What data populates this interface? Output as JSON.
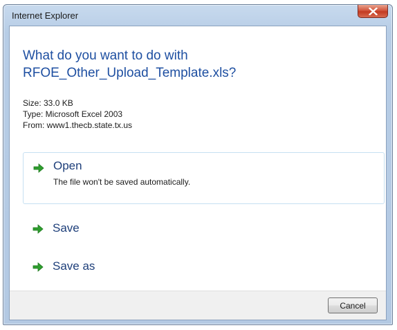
{
  "window": {
    "title": "Internet Explorer"
  },
  "dialog": {
    "question_line1": "What do you want to do with",
    "question_line2": "RFOE_Other_Upload_Template.xls?",
    "info": {
      "size": "Size: 33.0 KB",
      "type": "Type: Microsoft Excel 2003",
      "from": "From: www1.thecb.state.tx.us"
    },
    "options": [
      {
        "label": "Open",
        "description": "The file won't be saved automatically.",
        "icon": "green-arrow-icon"
      },
      {
        "label": "Save",
        "icon": "green-arrow-icon"
      },
      {
        "label": "Save as",
        "icon": "green-arrow-icon"
      }
    ],
    "cancel_label": "Cancel"
  },
  "colors": {
    "heading": "#1e4fa1",
    "option_label": "#1e3f7a",
    "arrow": "#2f9e2f",
    "close_button": "#c8462d"
  }
}
